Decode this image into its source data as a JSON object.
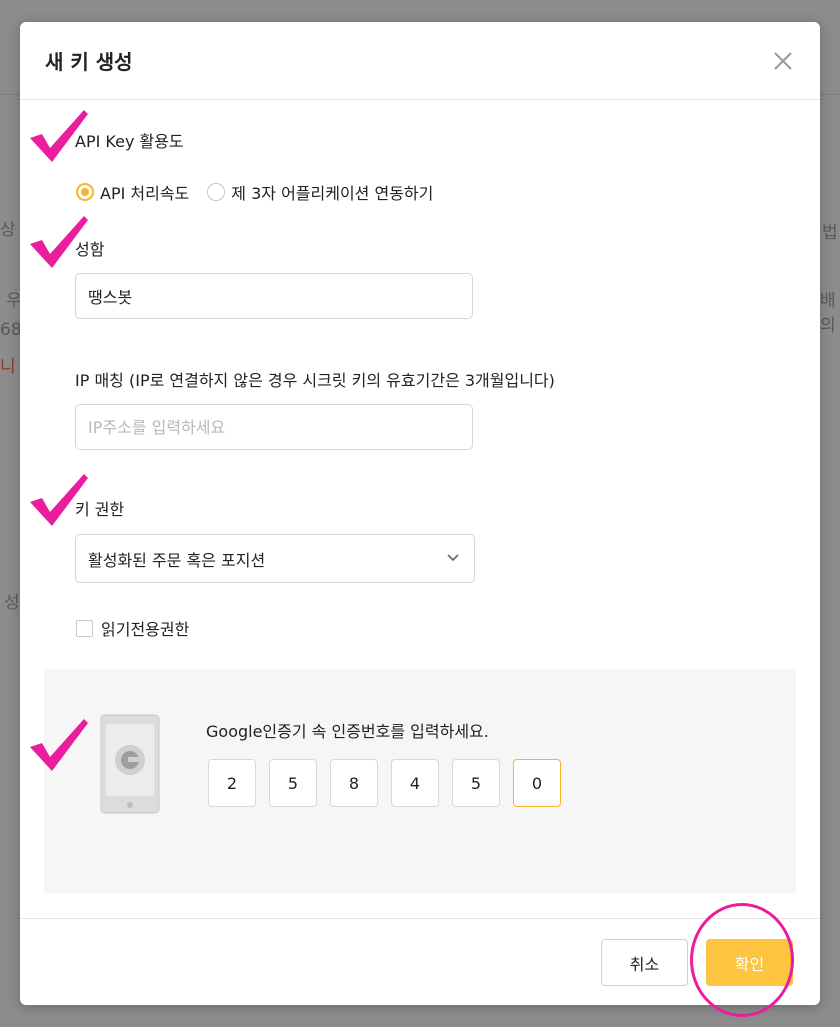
{
  "background": {
    "fragments": [
      "상 대",
      "우",
      "68",
      "니",
      "성",
      "법",
      "배의"
    ]
  },
  "modal": {
    "title": "새 키 생성",
    "close_icon": "close-icon"
  },
  "usage": {
    "label": "API Key 활용도",
    "options": [
      "API 처리속도",
      "제 3자 어플리케이션 연동하기"
    ],
    "selected_index": 0
  },
  "name": {
    "label": "성함",
    "value": "땡스봇"
  },
  "ip": {
    "label": "IP 매칭 (IP로 연결하지 않은 경우 시크릿 키의 유효기간은 3개월입니다)",
    "placeholder": "IP주소를 입력하세요"
  },
  "permission": {
    "label": "키 권한",
    "selected": "활성화된 주문 혹은 포지션",
    "readonly_label": "읽기전용권한",
    "readonly_checked": false
  },
  "otp": {
    "instruction": "Google인증기 속 인증번호를 입력하세요.",
    "digits": [
      "2",
      "5",
      "8",
      "4",
      "5",
      "0"
    ]
  },
  "footer": {
    "cancel_label": "취소",
    "confirm_label": "확인"
  },
  "colors": {
    "accent": "#f5b52e",
    "confirm_bg": "#fcc43f",
    "annotation": "#ea1e9c"
  }
}
